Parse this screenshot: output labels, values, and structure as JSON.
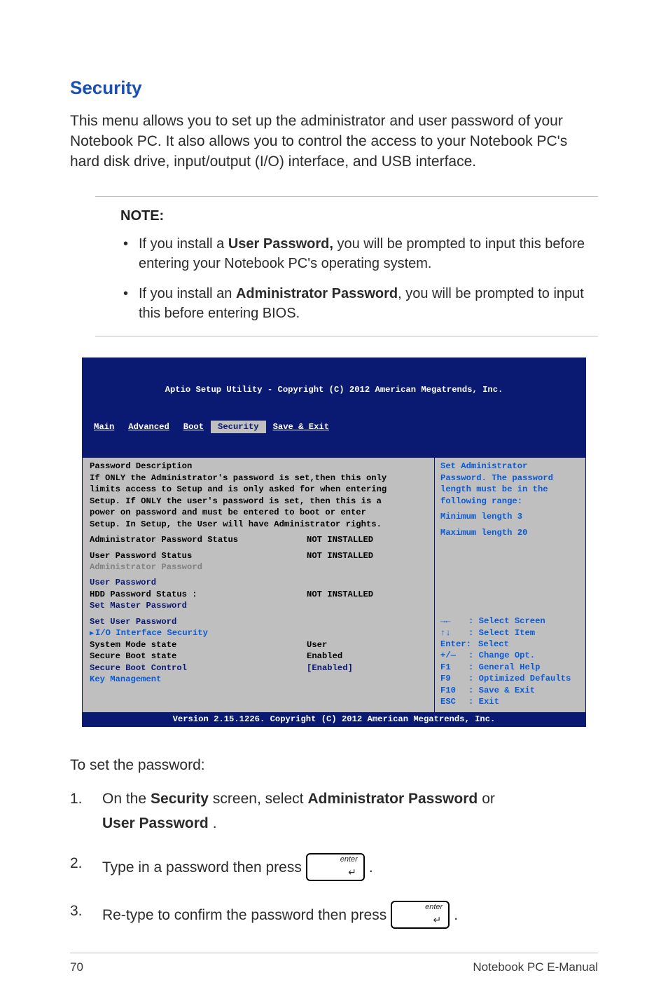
{
  "title": "Security",
  "intro": "This menu allows you to set up the administrator and user password of your Notebook PC. It also allows you to control the access to your Notebook PC's hard disk drive, input/output (I/O) interface, and USB interface.",
  "note": {
    "label": "NOTE:",
    "items": [
      {
        "pre": "If you install a ",
        "bold": "User Password,",
        "post": " you will be prompted to input this before entering your Notebook PC's operating system."
      },
      {
        "pre": "If you install an ",
        "bold": "Administrator Password",
        "post": ", you will be prompted to input this before entering BIOS."
      }
    ]
  },
  "bios": {
    "header": "Aptio Setup Utility - Copyright (C) 2012 American Megatrends, Inc.",
    "tabs": [
      "Main",
      "Advanced",
      "Boot",
      "Security",
      "Save & Exit"
    ],
    "active_tab": 3,
    "pwd_desc_title": "Password Description",
    "pwd_desc_text": "If ONLY the Administrator's password is set,then this only limits access to Setup and is only asked for when entering Setup. If ONLY the user's password is set, then this is a power on password and must be entered to boot or enter Setup. In Setup, the User will have Administrator rights.",
    "rows": {
      "admin_status_l": "Administrator Password Status",
      "admin_status_v": "NOT INSTALLED",
      "user_status_l": "User Password Status",
      "user_status_v": "NOT INSTALLED",
      "admin_pwd": "Administrator Password",
      "user_pwd": "User Password",
      "hdd_status_l": "HDD Password Status :",
      "hdd_status_v": "NOT INSTALLED",
      "set_master": "Set Master Password",
      "set_user": "Set User Password",
      "io_sec": "I/O Interface Security",
      "sysmode_l": "System Mode state",
      "sysmode_v": "User",
      "secboot_state_l": "Secure Boot state",
      "secboot_state_v": "Enabled",
      "secboot_ctrl_l": "Secure Boot Control",
      "secboot_ctrl_v": "[Enabled]",
      "keymgmt": "Key Management"
    },
    "right": {
      "t1": "Set Administrator",
      "t2": "Password. The password",
      "t3": "length must be in the",
      "t4": "following range:",
      "t5": "Minimum length 3",
      "t6": "Maximum length 20",
      "h1k": "→←",
      "h1v": ": Select Screen",
      "h2k": "↑↓",
      "h2v": ": Select Item",
      "h3k": "Enter:",
      "h3v": "Select",
      "h4k": "+/—",
      "h4v": ": Change Opt.",
      "h5k": "F1",
      "h5v": ": General Help",
      "h6k": "F9",
      "h6v": ": Optimized Defaults",
      "h7k": "F10",
      "h7v": ": Save & Exit",
      "h8k": "ESC",
      "h8v": ": Exit"
    },
    "footer": "Version 2.15.1226. Copyright (C) 2012 American Megatrends, Inc."
  },
  "instr": {
    "lead": "To set the password:",
    "s1a": "On the ",
    "s1b": "Security",
    "s1c": " screen, select ",
    "s1d": "Administrator Password",
    "s1e": " or ",
    "s1f": "User Password",
    "s1g": ".",
    "s2a": "Type in a password then press",
    "s2b": ".",
    "s3a": "Re-type to confirm the password then press",
    "s3b": ".",
    "key_label": "enter"
  },
  "footer": {
    "page": "70",
    "doc": "Notebook PC E-Manual"
  }
}
